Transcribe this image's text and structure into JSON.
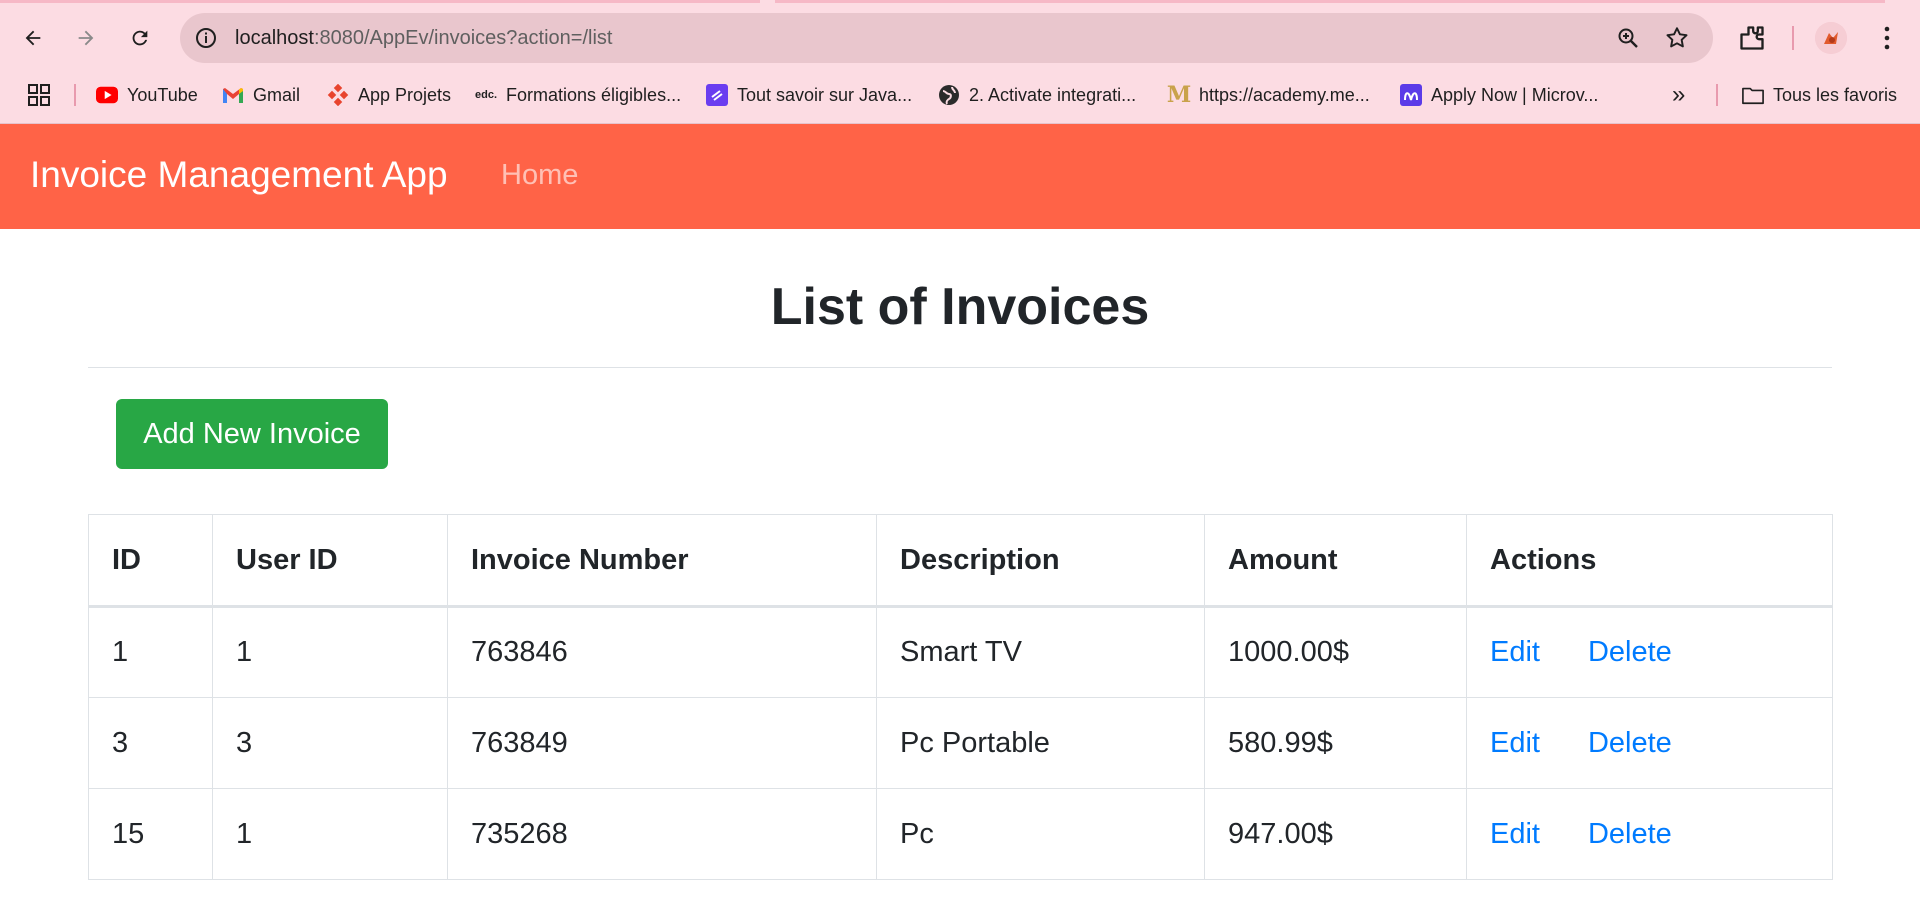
{
  "browser": {
    "url_host": "localhost",
    "url_path": ":8080/AppEv/invoices?action=/list",
    "bookmarks": [
      {
        "label": "YouTube",
        "icon": "youtube-icon"
      },
      {
        "label": "Gmail",
        "icon": "gmail-icon"
      },
      {
        "label": "App Projets",
        "icon": "app-projets-icon"
      },
      {
        "label": "Formations éligibles...",
        "icon": "edc-icon"
      },
      {
        "label": "Tout savoir sur Java...",
        "icon": "java-course-icon"
      },
      {
        "label": "2. Activate integrati...",
        "icon": "globe-icon"
      },
      {
        "label": "https://academy.me...",
        "icon": "academy-m-icon"
      },
      {
        "label": "Apply Now | Microv...",
        "icon": "microv-icon"
      }
    ],
    "more_bookmarks": "»",
    "all_bookmarks": "Tous les favoris"
  },
  "app": {
    "brand": "Invoice Management App",
    "nav_home": "Home",
    "accent_color": "#ff6347"
  },
  "main": {
    "title": "List of Invoices",
    "add_button": "Add New Invoice",
    "columns": [
      "ID",
      "User ID",
      "Invoice Number",
      "Description",
      "Amount",
      "Actions"
    ],
    "rows": [
      {
        "id": "1",
        "user_id": "1",
        "invoice_number": "763846",
        "description": "Smart TV",
        "amount": "1000.00$",
        "edit": "Edit",
        "delete": "Delete"
      },
      {
        "id": "3",
        "user_id": "3",
        "invoice_number": "763849",
        "description": "Pc Portable",
        "amount": "580.99$",
        "edit": "Edit",
        "delete": "Delete"
      },
      {
        "id": "15",
        "user_id": "1",
        "invoice_number": "735268",
        "description": "Pc",
        "amount": "947.00$",
        "edit": "Edit",
        "delete": "Delete"
      }
    ]
  }
}
